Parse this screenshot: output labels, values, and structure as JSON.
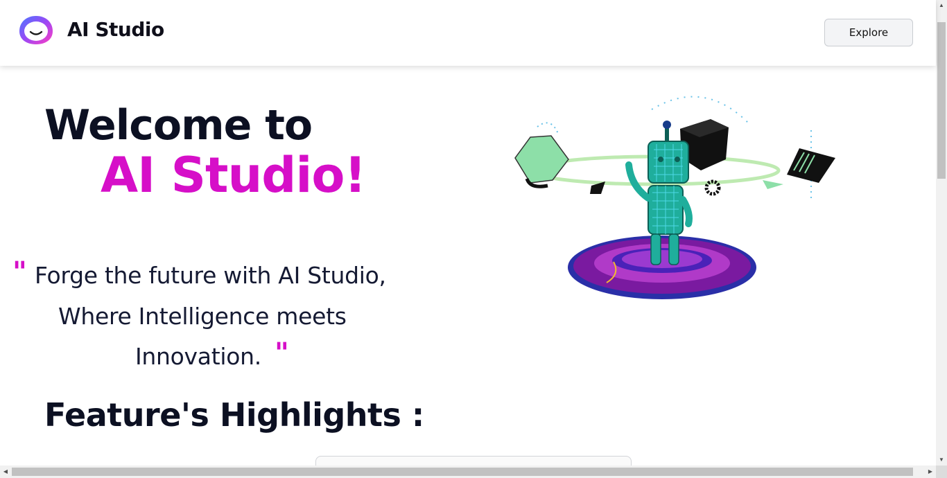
{
  "header": {
    "brand": "AI Studio",
    "explore_label": "Explore"
  },
  "hero": {
    "welcome": "Welcome to",
    "studio": "AI Studio!",
    "quote_open": "\"",
    "quote_close": "\"",
    "tagline": [
      "Forge the future with AI Studio,",
      "Where Intelligence meets",
      "Innovation."
    ],
    "features_title": "Feature's Highlights :"
  },
  "scrollbars": {
    "up_glyph": "▲",
    "down_glyph": "▼",
    "left_glyph": "◀",
    "right_glyph": "▶"
  },
  "colors": {
    "accent": "#d60fc8",
    "heading": "#0c1022",
    "robot": "#1fae9c",
    "shape_green": "#8ddfa8"
  },
  "icons": {
    "logo": "smiley-ring-icon",
    "robot": "robot-illustration"
  }
}
